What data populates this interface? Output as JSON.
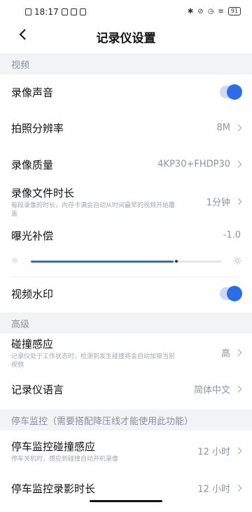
{
  "status": {
    "time": "18:17",
    "battery": "91"
  },
  "nav": {
    "title": "记录仪设置"
  },
  "video": {
    "header": "视频",
    "record_sound": {
      "label": "录像声音",
      "on": true
    },
    "photo_res": {
      "label": "拍照分辨率",
      "value": "8M"
    },
    "quality": {
      "label": "录像质量",
      "value": "4KP30+FHDP30"
    },
    "duration": {
      "label": "录像文件时长",
      "desc": "每段录像的时长，内存卡满会自动从时间最早的视频开始覆盖",
      "value": "1分钟"
    },
    "exposure": {
      "label": "曝光补偿",
      "value": "-1.0",
      "level": 0.75
    },
    "watermark": {
      "label": "视频水印",
      "on": true
    }
  },
  "advanced": {
    "header": "高级",
    "collision": {
      "label": "碰撞感应",
      "desc": "记录仪处于工作状态时，检测到发生碰撞将会自动加锁当前视频",
      "value": "高"
    },
    "language": {
      "label": "记录仪语言",
      "value": "简体中文"
    }
  },
  "parking": {
    "header": "停车监控（需要搭配降压线才能使用此功能）",
    "collision": {
      "label": "停车监控碰撞感应",
      "desc": "停车关机时，感应到碰撞自动开机录像",
      "value": "12 小时"
    },
    "duration": {
      "label": "停车监控录影时长",
      "value": "12 小时"
    }
  },
  "colors": {
    "accent": "#2b6de5",
    "section_bg": "#f2f3f5"
  }
}
